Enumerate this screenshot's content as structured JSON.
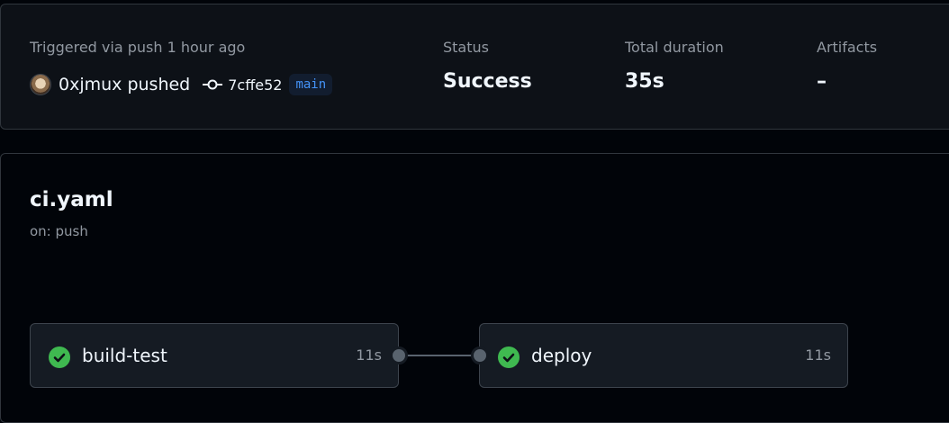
{
  "summary": {
    "trigger_text": "Triggered via push 1 hour ago",
    "actor": "0xjmux pushed",
    "commit_sha": "7cffe52",
    "branch": "main",
    "status_label": "Status",
    "status_value": "Success",
    "duration_label": "Total duration",
    "duration_value": "35s",
    "artifacts_label": "Artifacts",
    "artifacts_value": "–"
  },
  "workflow": {
    "title": "ci.yaml",
    "trigger": "on: push",
    "jobs": [
      {
        "name": "build-test",
        "duration": "11s",
        "status": "success"
      },
      {
        "name": "deploy",
        "duration": "11s",
        "status": "success"
      }
    ]
  },
  "colors": {
    "success": "#3fb950",
    "branch_text": "#4493f8",
    "background": "#010409",
    "panel": "#0d1117"
  },
  "icons": [
    "avatar",
    "git-commit-icon",
    "check-circle-icon"
  ]
}
